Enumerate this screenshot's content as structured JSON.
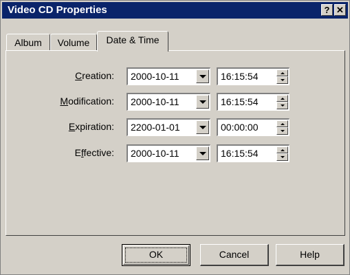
{
  "window": {
    "title": "Video CD Properties",
    "help_button": "?",
    "close_button": "✕"
  },
  "tabs": [
    {
      "label": "Album",
      "active": false
    },
    {
      "label": "Volume",
      "active": false
    },
    {
      "label": "Date & Time",
      "active": true
    }
  ],
  "rows": [
    {
      "label_first": "C",
      "label_rest": "reation:",
      "date": "2000-10-11",
      "time": "16:15:54"
    },
    {
      "label_first": "M",
      "label_rest": "odification:",
      "date": "2000-10-11",
      "time": "16:15:54"
    },
    {
      "label_first": "E",
      "label_rest": "xpiration:",
      "date": "2200-01-01",
      "time": "00:00:00"
    },
    {
      "label_pre": "E",
      "label_first": "f",
      "label_rest": "fective:",
      "date": "2000-10-11",
      "time": "16:15:54"
    }
  ],
  "buttons": {
    "ok": "OK",
    "cancel": "Cancel",
    "help": "Help"
  },
  "colors": {
    "titlebar": "#0a246a",
    "face": "#d4d0c8"
  }
}
